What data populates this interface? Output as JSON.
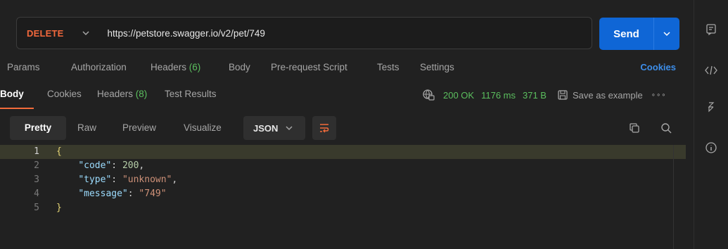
{
  "request": {
    "method": "DELETE",
    "url": "https://petstore.swagger.io/v2/pet/749",
    "send_label": "Send"
  },
  "request_tabs": [
    {
      "label": "Params"
    },
    {
      "label": "Authorization"
    },
    {
      "label": "Headers",
      "count": "(6)"
    },
    {
      "label": "Body"
    },
    {
      "label": "Pre-request Script"
    },
    {
      "label": "Tests"
    },
    {
      "label": "Settings"
    }
  ],
  "cookies_link": "Cookies",
  "response_tabs": [
    {
      "label": "Body"
    },
    {
      "label": "Cookies"
    },
    {
      "label": "Headers",
      "count": "(8)"
    },
    {
      "label": "Test Results"
    }
  ],
  "response_status": {
    "status": "200 OK",
    "time": "1176 ms",
    "size": "371 B",
    "save_label": "Save as example",
    "more": "∘∘∘"
  },
  "editor": {
    "formats": [
      "Pretty",
      "Raw",
      "Preview",
      "Visualize"
    ],
    "active_format": "Pretty",
    "language": "JSON"
  },
  "code_lines": [
    {
      "n": "1"
    },
    {
      "n": "2",
      "key": "\"code\"",
      "value": "200",
      "trail": ","
    },
    {
      "n": "3",
      "key": "\"type\"",
      "value": "\"unknown\"",
      "trail": ","
    },
    {
      "n": "4",
      "key": "\"message\"",
      "value": "\"749\"",
      "trail": ""
    },
    {
      "n": "5"
    }
  ],
  "colors": {
    "accent_method": "#f2683c",
    "send_button": "#0f66d6",
    "status_green": "#5bbf5e",
    "cookies_link": "#3d8eea"
  },
  "icons": {
    "rail": [
      "comment-icon",
      "code-icon",
      "cookie-transfer-icon",
      "info-icon"
    ],
    "toolbar": [
      "word-wrap-icon",
      "copy-icon",
      "search-icon"
    ]
  }
}
